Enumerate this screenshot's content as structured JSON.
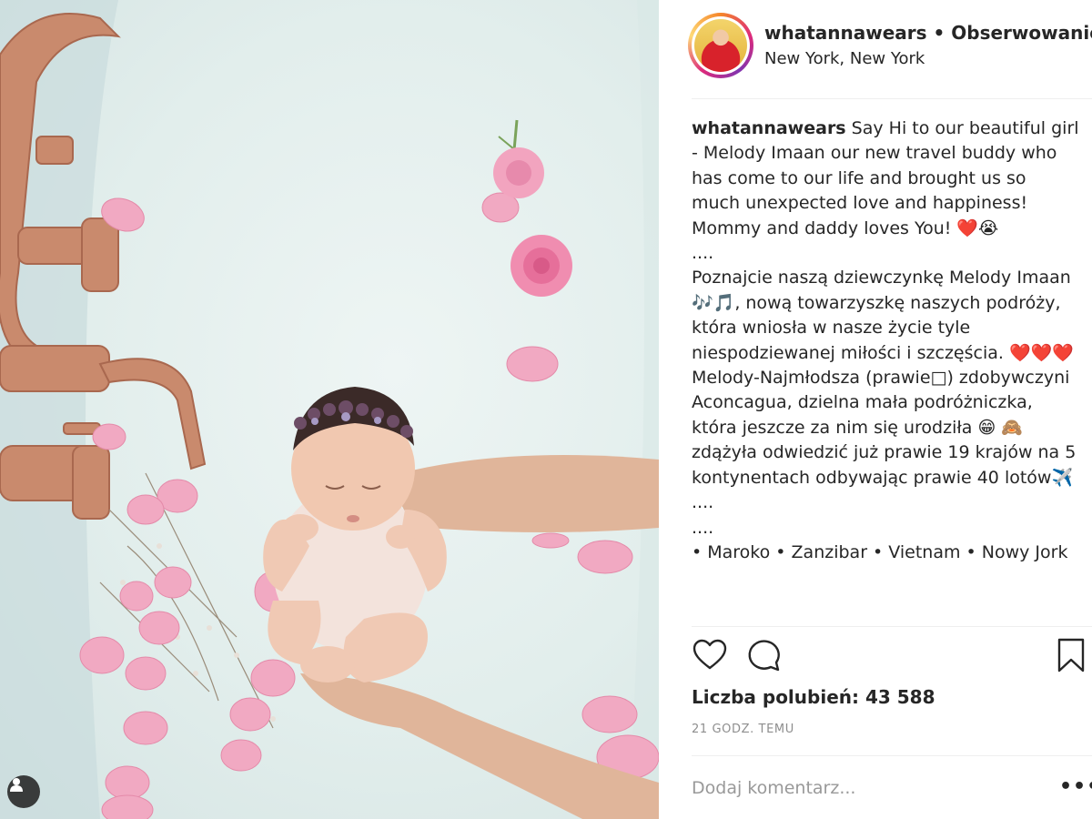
{
  "post": {
    "username": "whatannawears",
    "separator": " • ",
    "follow_label": "Obserwowanie",
    "location": "New York, New York"
  },
  "caption": {
    "username": "whatannawears",
    "p1": "Say Hi to our beautiful girl - Melody Imaan our new travel buddy who has come to our life and brought us so much unexpected love and happiness! Mommy and daddy loves You! ❤️😭",
    "p2": "....",
    "p3": "Poznajcie naszą dziewczynkę Melody Imaan 🎶🎵, nową towarzyszkę naszych podróży, która wniosła w nasze życie tyle niespodziewanej miłości i szczęścia. ❤️❤️❤️",
    "p4": "Melody-Najmłodsza (prawie□) zdobywczyni Aconcagua, dzielna mała podróżniczka, która jeszcze za nim się urodziła 😁 🙈 zdążyła odwiedzić już prawie 19 krajów na 5 kontynentach odbywając prawie 40 lotów✈️ ....",
    "p5": "....",
    "p6": "• Maroko • Zanzibar • Vietnam • Nowy Jork"
  },
  "likes_text": "Liczba polubień: 43 588",
  "timestamp": "21 GODZ. TEMU",
  "comment": {
    "placeholder": "Dodaj komentarz...",
    "value": ""
  },
  "more_label": "•••",
  "icons": {
    "like": "heart-outline-icon",
    "comment": "speech-bubble-icon",
    "save": "bookmark-icon",
    "tag": "person-tag-icon"
  },
  "colors": {
    "text": "#262626",
    "muted": "#8e8e8e",
    "border": "#efefef"
  }
}
